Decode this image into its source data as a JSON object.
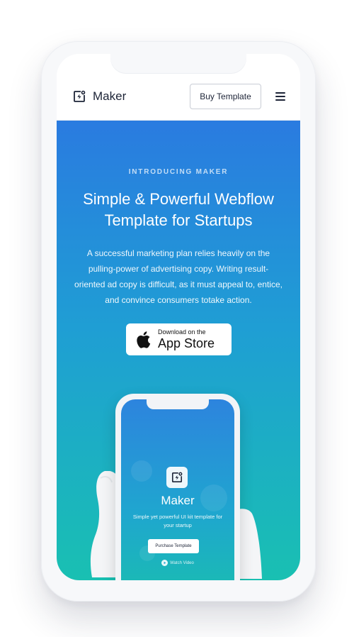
{
  "nav": {
    "brand": "Maker",
    "buy_button": "Buy Template",
    "menu_icon": "hamburger-menu-icon"
  },
  "hero": {
    "eyebrow": "INTRODUCING MAKER",
    "headline": "Simple & Powerful Webflow Template for Startups",
    "lede": "A successful marketing plan relies heavily on the pulling-power of advertising copy. Writing result-oriented ad copy is difficult, as it must appeal to, entice, and convince consumers totake action.",
    "appstore": {
      "small": "Download on the",
      "big": "App Store"
    }
  },
  "mockup": {
    "brand": "Maker",
    "subtitle": "Simple yet powerful UI kit template for your startup",
    "button": "Purchase Template",
    "video_link": "Watch Video"
  },
  "colors": {
    "gradient_top": "#2a7be0",
    "gradient_bottom": "#19c0b2",
    "text_dark": "#1d2437"
  }
}
